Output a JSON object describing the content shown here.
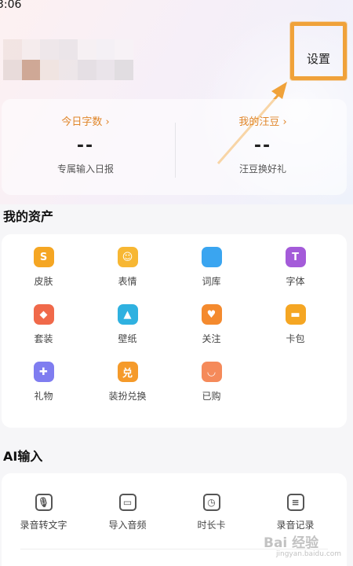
{
  "status_bar": {
    "time": "3:06"
  },
  "header": {
    "settings_label": "设置"
  },
  "stats": [
    {
      "title": "今日字数 ›",
      "value": "--",
      "subtitle": "专属输入日报"
    },
    {
      "title": "我的汪豆 ›",
      "value": "--",
      "subtitle": "汪豆换好礼"
    }
  ],
  "assets": {
    "title": "我的资产",
    "items": [
      {
        "label": "皮肤",
        "icon": "shirt-icon",
        "color": "#f5a623",
        "glyph": "S"
      },
      {
        "label": "表情",
        "icon": "smiley-icon",
        "color": "#f7b733",
        "glyph": "☺"
      },
      {
        "label": "词库",
        "icon": "book-icon",
        "color": "#3aa5f0",
        "glyph": ""
      },
      {
        "label": "字体",
        "icon": "font-bag-icon",
        "color": "#a45bd9",
        "glyph": "T"
      },
      {
        "label": "套装",
        "icon": "suit-icon",
        "color": "#f0694a",
        "glyph": "◆"
      },
      {
        "label": "壁纸",
        "icon": "image-icon",
        "color": "#2fb1e0",
        "glyph": "▲"
      },
      {
        "label": "关注",
        "icon": "heart-icon",
        "color": "#f48a2e",
        "glyph": "♥"
      },
      {
        "label": "卡包",
        "icon": "card-icon",
        "color": "#f5a623",
        "glyph": "▬"
      },
      {
        "label": "礼物",
        "icon": "gift-icon",
        "color": "#7f7df0",
        "glyph": "✚"
      },
      {
        "label": "装扮兑换",
        "icon": "exchange-icon",
        "color": "#f59a2a",
        "glyph": "兑"
      },
      {
        "label": "已购",
        "icon": "shopping-bag-icon",
        "color": "#f58a5a",
        "glyph": "◡"
      }
    ]
  },
  "ai_input": {
    "title": "AI输入",
    "items": [
      {
        "label": "录音转文字",
        "icon": "microphone-icon",
        "glyph": "🎙"
      },
      {
        "label": "导入音频",
        "icon": "folder-audio-icon",
        "glyph": "▭"
      },
      {
        "label": "时长卡",
        "icon": "clock-card-icon",
        "glyph": "◷"
      },
      {
        "label": "录音记录",
        "icon": "document-list-icon",
        "glyph": "≡"
      }
    ]
  },
  "watermark": {
    "text": "Bai 经验",
    "sub": "jingyan.baidu.com"
  },
  "colors": {
    "accent_orange": "#e0862a",
    "highlight_box": "#f0a23a"
  }
}
